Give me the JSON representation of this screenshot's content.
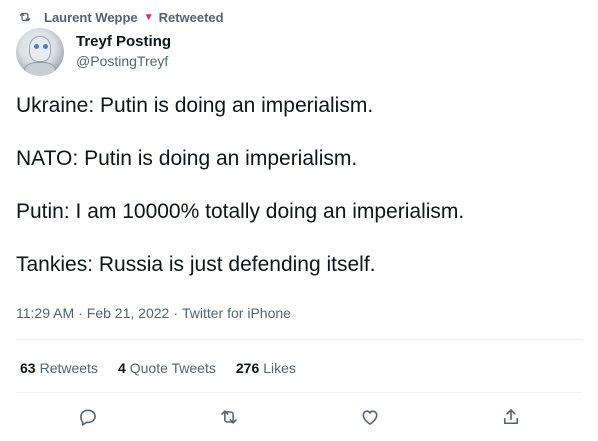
{
  "retweet_context": {
    "user": "Laurent Weppe",
    "label": "Retweeted"
  },
  "author": {
    "display_name": "Treyf Posting",
    "handle": "@PostingTreyf"
  },
  "tweet": {
    "lines": [
      "Ukraine: Putin is doing an imperialism.",
      "NATO: Putin is doing an imperialism.",
      "Putin: I am 10000% totally doing an imperialism.",
      "Tankies: Russia is just defending itself."
    ],
    "time": "11:29 AM",
    "date": "Feb 21, 2022",
    "source": "Twitter for iPhone"
  },
  "stats": {
    "retweets_count": "63",
    "retweets_label": "Retweets",
    "quotes_count": "4",
    "quotes_label": "Quote Tweets",
    "likes_count": "276",
    "likes_label": "Likes"
  },
  "actions": {
    "reply_icon": "reply-icon",
    "retweet_icon": "retweet-icon",
    "like_icon": "like-icon",
    "share_icon": "share-icon"
  },
  "colors": {
    "primary_text": "#0f1419",
    "secondary_text": "#536471",
    "divider": "#eff3f4",
    "retweet_mark": "#e0245e"
  }
}
